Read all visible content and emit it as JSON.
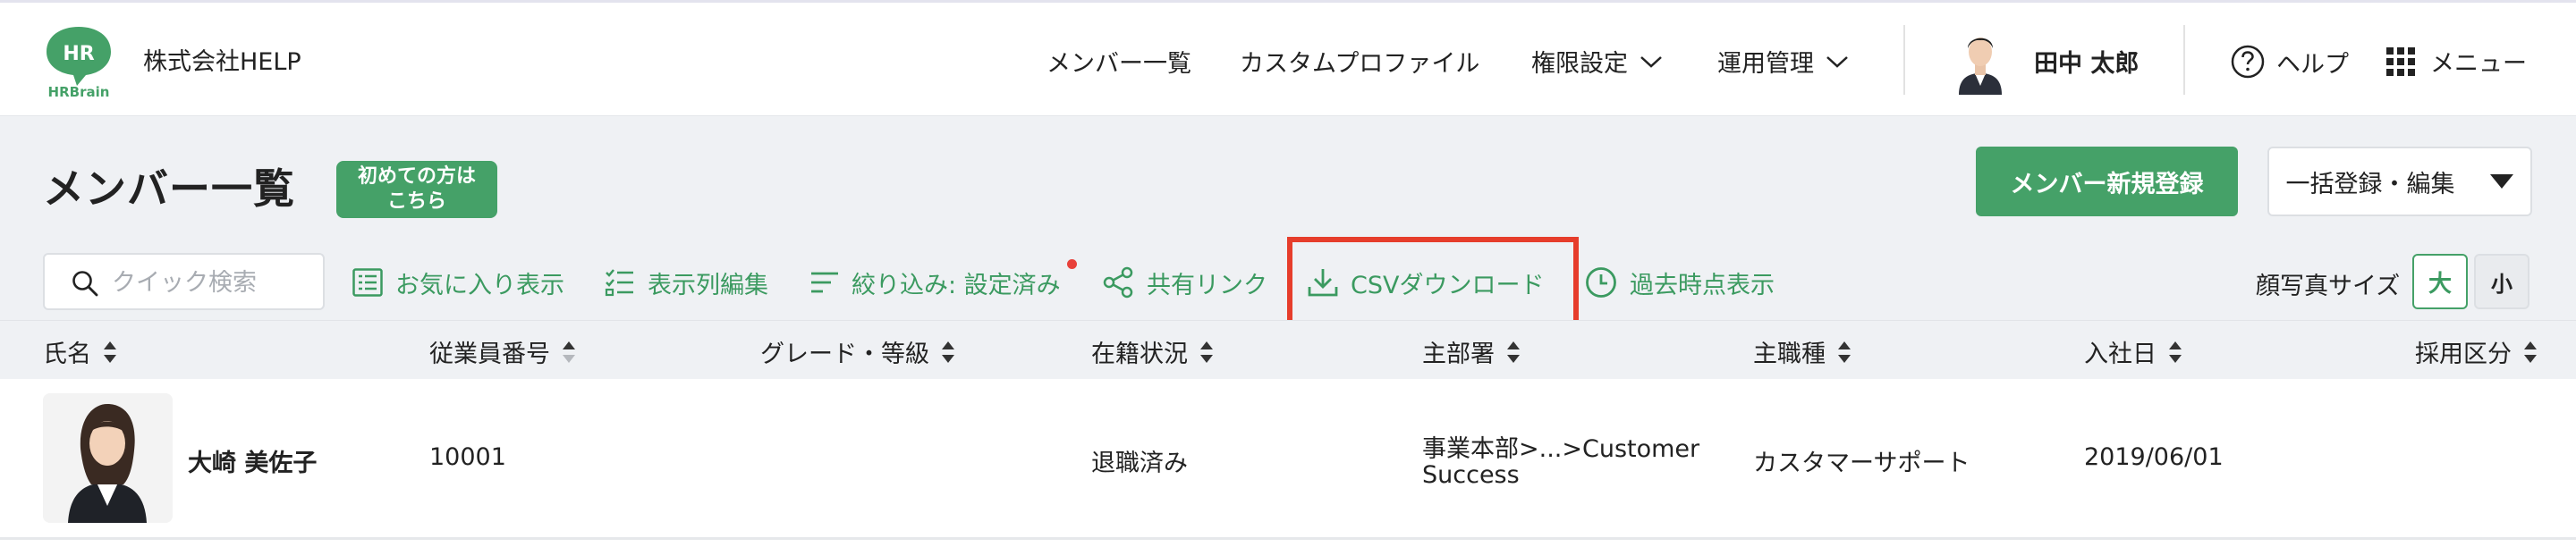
{
  "header": {
    "logo_text": "HR",
    "logo_brand": "HRBrain",
    "company": "株式会社HELP",
    "nav": [
      {
        "label": "メンバー一覧",
        "dropdown": false
      },
      {
        "label": "カスタムプロファイル",
        "dropdown": false
      },
      {
        "label": "権限設定",
        "dropdown": true
      },
      {
        "label": "運用管理",
        "dropdown": true
      }
    ],
    "user_name": "田中 太郎",
    "help_label": "ヘルプ",
    "menu_label": "メニュー"
  },
  "page": {
    "title": "メンバー一覧",
    "first_badge_line1": "初めての方は",
    "first_badge_line2": "こちら",
    "register_button": "メンバー新規登録",
    "bulk_button": "一括登録・編集"
  },
  "toolbar": {
    "search_placeholder": "クイック検索",
    "favorites": "お気に入り表示",
    "columns": "表示列編集",
    "filter": "絞り込み: 設定済み",
    "share": "共有リンク",
    "csv": "CSVダウンロード",
    "history": "過去時点表示",
    "photo_size_label": "顔写真サイズ",
    "size_large": "大",
    "size_small": "小"
  },
  "table": {
    "columns": [
      "氏名",
      "従業員番号",
      "グレード・等級",
      "在籍状況",
      "主部署",
      "主職種",
      "入社日",
      "採用区分"
    ],
    "rows": [
      {
        "name": "大崎 美佐子",
        "employee_no": "10001",
        "grade": "",
        "status": "退職済み",
        "dept_line1": "事業本部>...>Customer",
        "dept_line2": "Success",
        "job": "カスタマーサポート",
        "joined": "2019/06/01",
        "hire_type": ""
      }
    ]
  },
  "colors": {
    "accent": "#45a168",
    "accent_text": "#3b9a60",
    "highlight": "#e63d2b",
    "notice_dot": "#e8413a",
    "band_bg": "#eff1f4"
  },
  "icons": [
    "search-icon",
    "list-star-icon",
    "checklist-icon",
    "filter-icon",
    "share-icon",
    "download-icon",
    "clock-icon",
    "help-circle-icon",
    "grid-menu-icon",
    "chevron-down-icon",
    "sort-icon",
    "caret-down-icon"
  ]
}
